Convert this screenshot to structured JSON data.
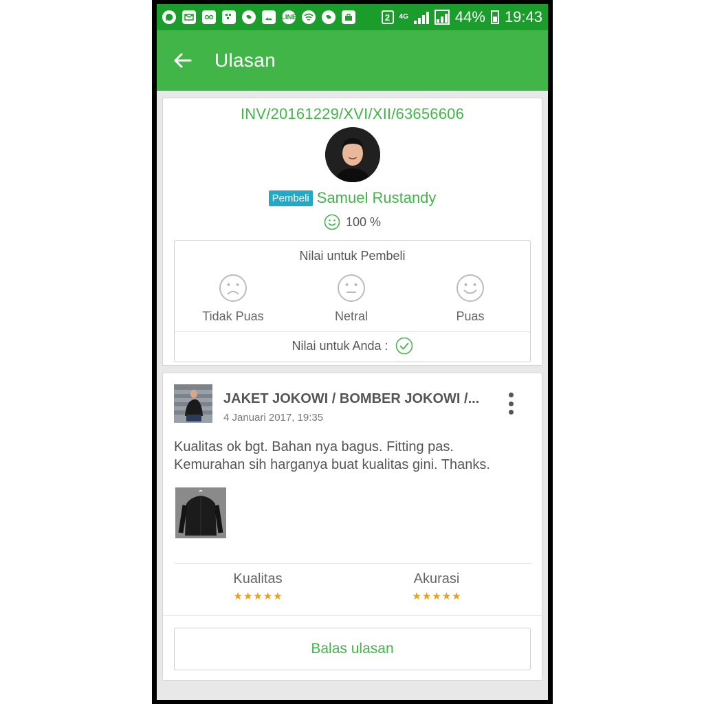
{
  "status_bar": {
    "sim": "2",
    "network": "4G",
    "battery": "44%",
    "time": "19:43"
  },
  "app_bar": {
    "title": "Ulasan"
  },
  "buyer_card": {
    "invoice": "INV/20161229/XVI/XII/63656606",
    "badge": "Pembeli",
    "buyer_name": "Samuel Rustandy",
    "reputation": "100 %",
    "rating_title": "Nilai untuk Pembeli",
    "options": [
      "Tidak Puas",
      "Netral",
      "Puas"
    ],
    "your_rating": "Nilai untuk Anda :"
  },
  "review_card": {
    "product_title": "JAKET JOKOWI / BOMBER JOKOWI /...",
    "date": "4 Januari 2017, 19:35",
    "review_text_line1": "Kualitas ok bgt. Bahan nya bagus. Fitting pas.",
    "review_text_line2": "Kemurahan sih harganya buat kualitas gini. Thanks.",
    "attributes": [
      {
        "label": "Kualitas",
        "stars": 5
      },
      {
        "label": "Akurasi",
        "stars": 5
      }
    ],
    "reply_button": "Balas ulasan"
  },
  "colors": {
    "status_bar": "#1a9d2a",
    "app_bar": "#42b549",
    "accent_green": "#42b549",
    "badge": "#23a9c6",
    "star": "#f39c12"
  }
}
